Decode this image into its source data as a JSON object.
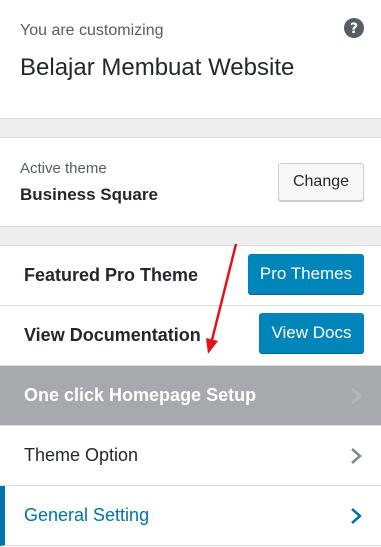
{
  "header": {
    "subtitle": "You are customizing",
    "site_title": "Belajar Membuat Website",
    "help_icon": "help-icon"
  },
  "active_theme": {
    "label": "Active theme",
    "name": "Business Square",
    "change_label": "Change"
  },
  "sections": [
    {
      "title": "Featured Pro Theme",
      "button_label": "Pro Themes"
    },
    {
      "title": "View Documentation",
      "button_label": "View Docs"
    },
    {
      "title": "One click Homepage Setup",
      "icon": "chevron-right-icon"
    },
    {
      "title": "Theme Option",
      "icon": "chevron-right-icon"
    },
    {
      "title": "General Setting",
      "icon": "chevron-right-icon"
    }
  ],
  "colors": {
    "accent": "#0085ba",
    "active_text": "#0073aa",
    "highlight_row": "#a6a9ad",
    "annotation_arrow": "#e3121b"
  }
}
